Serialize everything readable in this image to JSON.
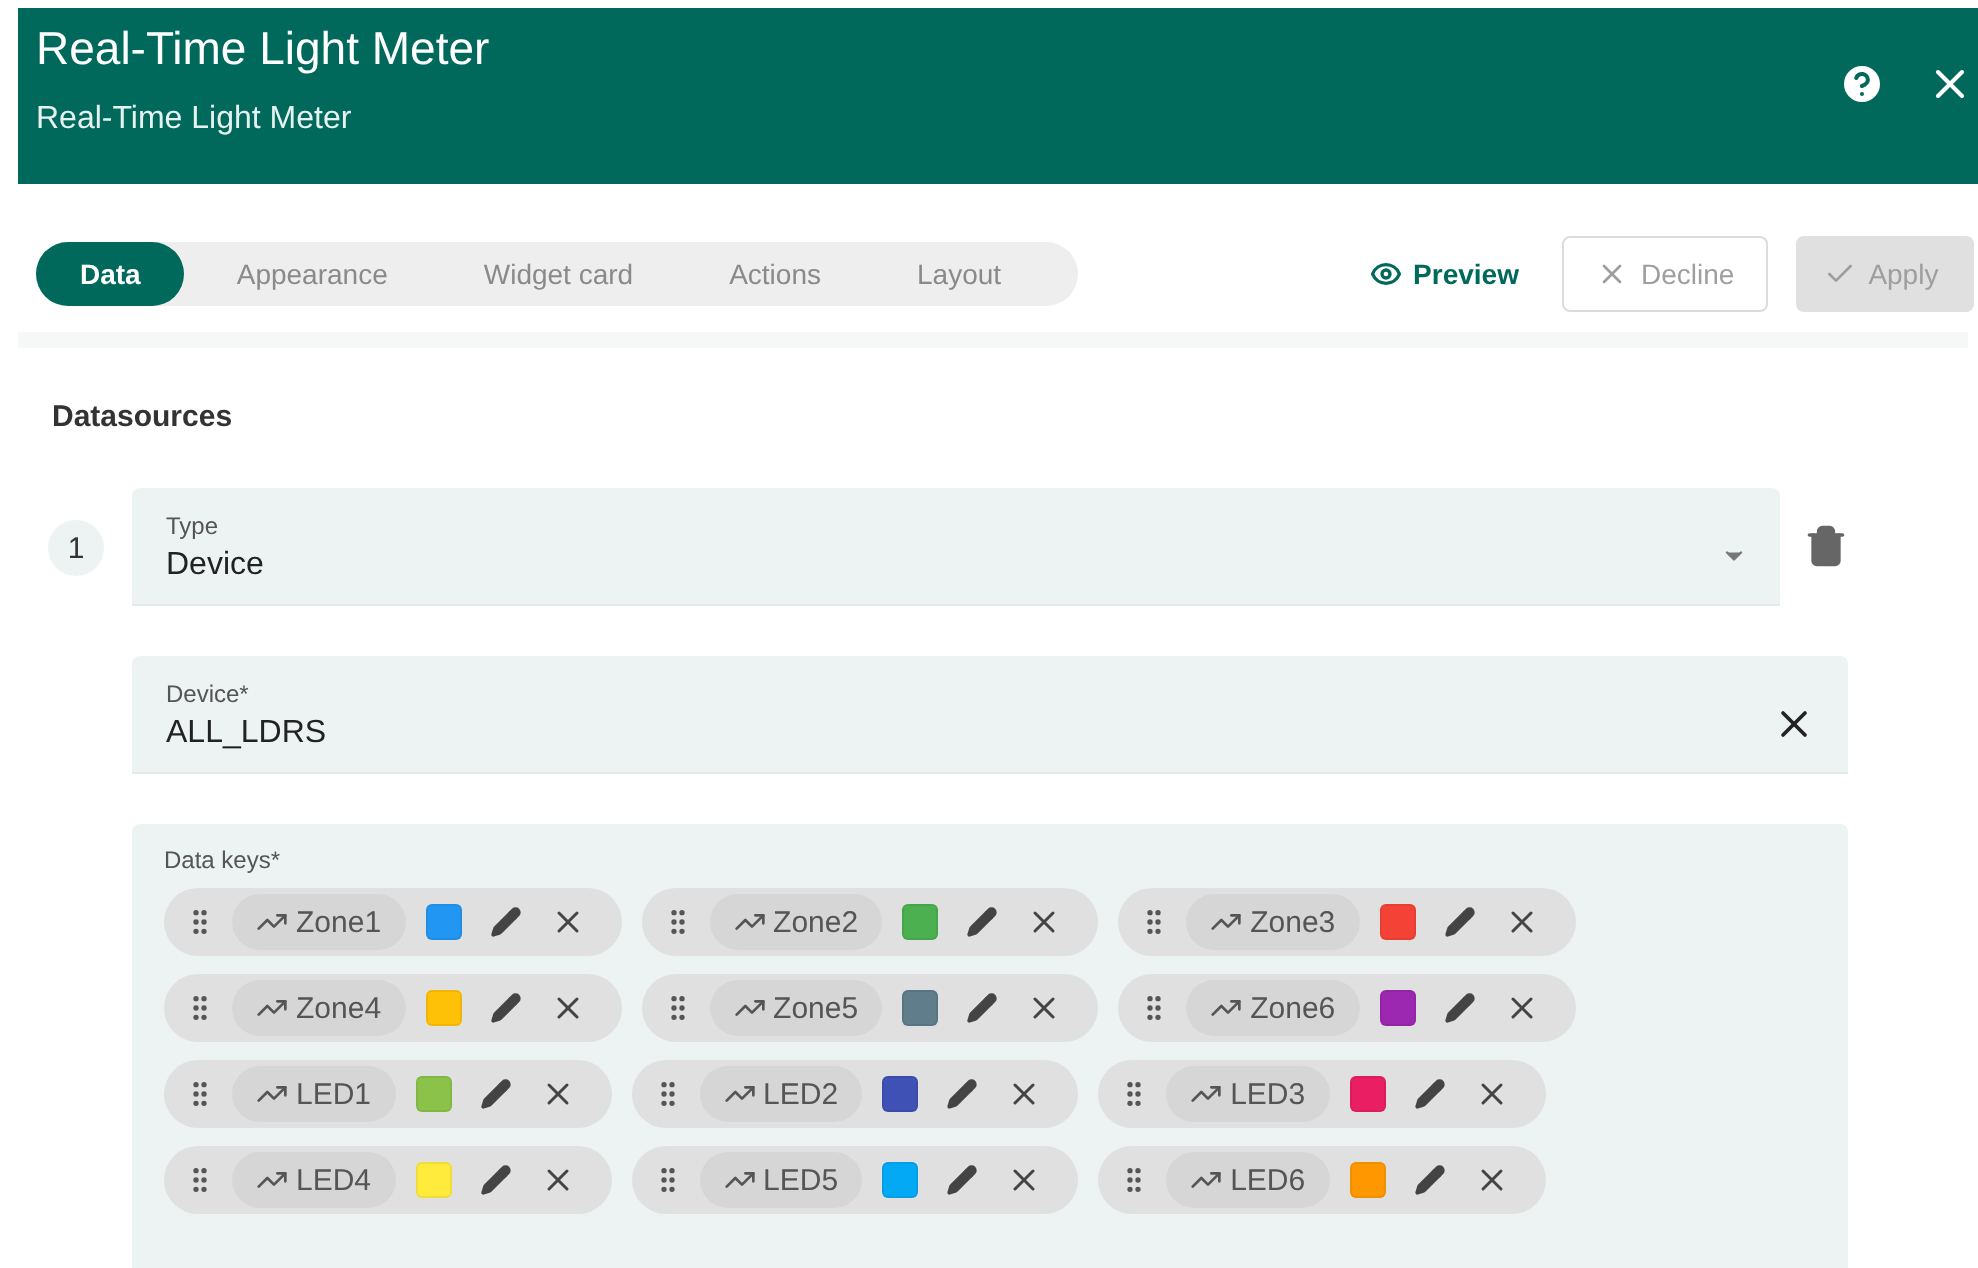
{
  "header": {
    "title": "Real-Time Light Meter",
    "subtitle": "Real-Time Light Meter"
  },
  "tabs": [
    {
      "label": "Data",
      "selected": true
    },
    {
      "label": "Appearance",
      "selected": false
    },
    {
      "label": "Widget card",
      "selected": false
    },
    {
      "label": "Actions",
      "selected": false
    },
    {
      "label": "Layout",
      "selected": false
    }
  ],
  "actions": {
    "preview": "Preview",
    "decline": "Decline",
    "apply": "Apply",
    "apply_disabled": true
  },
  "section_title": "Datasources",
  "datasources": [
    {
      "index": "1",
      "type_label": "Type",
      "type_value": "Device",
      "device_label": "Device*",
      "device_value": "ALL_LDRS",
      "keys_label": "Data keys*",
      "keys": [
        {
          "name": "Zone1",
          "color": "#2196f3"
        },
        {
          "name": "Zone2",
          "color": "#4caf50"
        },
        {
          "name": "Zone3",
          "color": "#f44336"
        },
        {
          "name": "Zone4",
          "color": "#ffc107"
        },
        {
          "name": "Zone5",
          "color": "#607d8b"
        },
        {
          "name": "Zone6",
          "color": "#9c27b0"
        },
        {
          "name": "LED1",
          "color": "#8bc34a"
        },
        {
          "name": "LED2",
          "color": "#3f51b5"
        },
        {
          "name": "LED3",
          "color": "#e91e63"
        },
        {
          "name": "LED4",
          "color": "#ffeb3b"
        },
        {
          "name": "LED5",
          "color": "#03a9f4"
        },
        {
          "name": "LED6",
          "color": "#ff9800"
        }
      ]
    }
  ]
}
